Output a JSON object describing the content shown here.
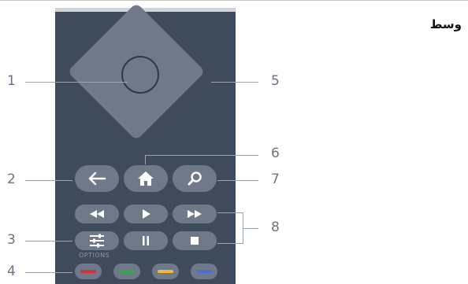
{
  "heading": "وسط",
  "remote": {
    "options_label": "OPTIONS",
    "color_keys": {
      "red": "#d0323c",
      "green": "#3aa64a",
      "yellow": "#f0b93a",
      "blue": "#4a6fd0"
    },
    "icons": [
      "back-icon",
      "home-icon",
      "search-icon",
      "rewind-icon",
      "play-icon",
      "fast-forward-icon",
      "options-icon",
      "pause-icon",
      "stop-icon"
    ]
  },
  "callouts": {
    "n1": "1",
    "n2": "2",
    "n3": "3",
    "n4": "4",
    "n5": "5",
    "n6": "6",
    "n7": "7",
    "n8": "8"
  },
  "colors": {
    "remote_body": "#3f4a5b",
    "button": "#6f7989",
    "callout_line": "#9aa3ae",
    "callout_number": "#6b7380"
  }
}
